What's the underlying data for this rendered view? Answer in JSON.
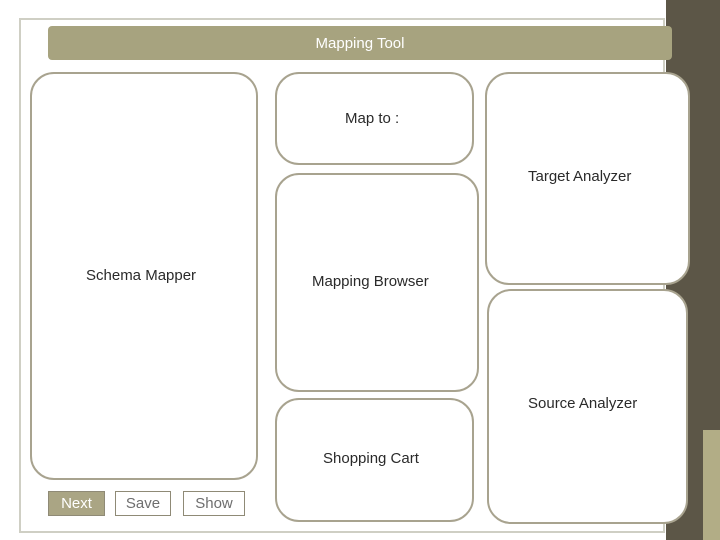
{
  "header": {
    "title": "Mapping Tool"
  },
  "panels": {
    "map_to": "Map to :",
    "target_analyzer": "Target  Analyzer",
    "schema_mapper": "Schema Mapper",
    "mapping_browser": "Mapping Browser",
    "source_analyzer": "Source Analyzer",
    "shopping_cart": "Shopping Cart"
  },
  "buttons": {
    "next": "Next",
    "save": "Save",
    "show": "Show"
  },
  "colors": {
    "title_bar": "#a7a37f",
    "panel_border": "#a8a38f",
    "side_dark": "#5c5647",
    "button_dark": "#aaa584"
  }
}
